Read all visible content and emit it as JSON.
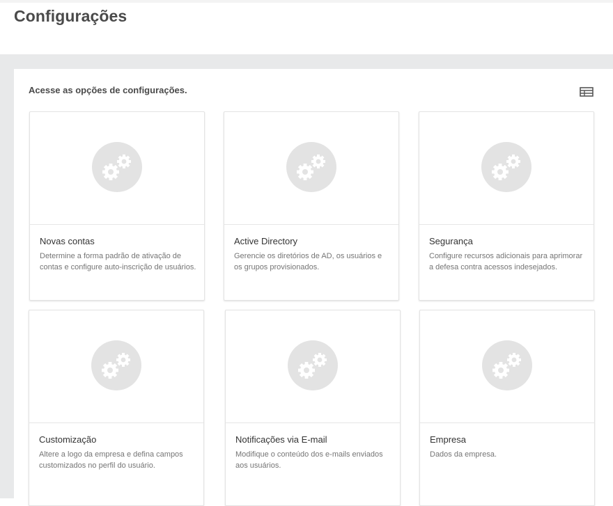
{
  "page": {
    "title": "Configurações"
  },
  "panel": {
    "subtitle": "Acesse as opções de configurações.",
    "view_toggle_icon": "table-view-icon"
  },
  "cards": [
    {
      "title": "Novas contas",
      "description": "Determine a forma padrão de ativação de contas e configure auto-inscrição de usuários.",
      "icon": "gears-icon"
    },
    {
      "title": "Active Directory",
      "description": "Gerencie os diretórios de AD, os usuários e os grupos provisionados.",
      "icon": "gears-icon"
    },
    {
      "title": "Segurança",
      "description": "Configure recursos adicionais para aprimorar a defesa contra acessos indesejados.",
      "icon": "gears-icon"
    },
    {
      "title": "Customização",
      "description": "Altere a logo da empresa e defina campos customizados no perfil do usuário.",
      "icon": "gears-icon"
    },
    {
      "title": "Notificações via E-mail",
      "description": "Modifique o conteúdo dos e-mails enviados aos usuários.",
      "icon": "gears-icon"
    },
    {
      "title": "Empresa",
      "description": "Dados da empresa.",
      "icon": "gears-icon"
    }
  ],
  "colors": {
    "background": "#e8e9ea",
    "icon_circle": "#e3e3e3",
    "icon_gear": "#ffffff"
  }
}
